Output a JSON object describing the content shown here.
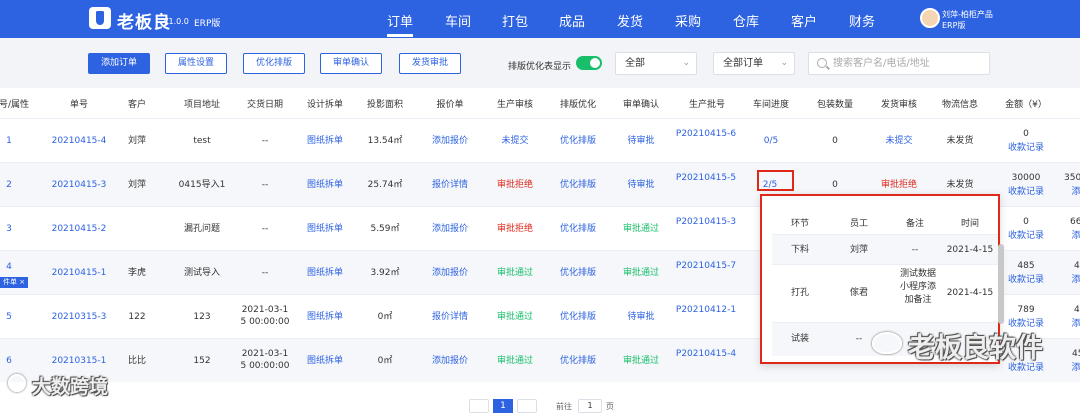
{
  "header": {
    "brand": "老板良",
    "version": "V1.0.0",
    "edition": "ERP版",
    "nav": [
      "订单",
      "车间",
      "打包",
      "成品",
      "发货",
      "采购",
      "仓库",
      "客户",
      "财务"
    ],
    "active_nav": "订单",
    "user_name": "刘萍-柏柜产品",
    "user_role": "ERP版"
  },
  "toolbar": {
    "buttons": [
      "添加订单",
      "属性设置",
      "优化排版",
      "审单确认",
      "发货审批"
    ],
    "toggle_label": "排版优化表显示",
    "toggle_on": true,
    "select1": "全部",
    "select2": "全部订单",
    "search_placeholder": "搜索客户名/电话/地址"
  },
  "table": {
    "headers": [
      "号/属性",
      "单号",
      "客户",
      "项目地址",
      "交货日期",
      "设计拆单",
      "投影面积",
      "报价单",
      "生产审核",
      "排版优化",
      "审单确认",
      "生产批号",
      "车间进度",
      "包装数量",
      "发货审核",
      "物流信息",
      "金额（¥）"
    ],
    "rows": [
      {
        "no": "1",
        "tag": "",
        "order": "20210415-4",
        "customer": "刘萍",
        "address": "test",
        "date": "--",
        "design": "图纸拆单",
        "area": "13.54㎡",
        "quote": "添加报价",
        "prod_review": "未提交",
        "layout": "优化排版",
        "confirm": "待审批",
        "batch": "P20210415-6",
        "progress": "0/5",
        "pack": "0",
        "ship_review": "未提交",
        "logistics": "未发货",
        "amount": "0",
        "amount_link": "收款记录",
        "extra": "",
        "extra2": ""
      },
      {
        "no": "2",
        "tag": "",
        "order": "20210415-3",
        "customer": "刘萍",
        "address": "0415导入1",
        "date": "--",
        "design": "图纸拆单",
        "area": "25.74㎡",
        "quote": "报价详情",
        "prod_review": "审批拒绝",
        "layout": "优化排版",
        "confirm": "待审批",
        "batch": "P20210415-5",
        "progress": "2/5",
        "pack": "0",
        "ship_review": "审批拒绝",
        "logistics": "未发货",
        "amount": "30000",
        "amount_link": "收款记录",
        "extra": "350",
        "extra2": "添"
      },
      {
        "no": "3",
        "tag": "",
        "order": "20210415-2",
        "customer": "",
        "address": "漏孔问题",
        "date": "--",
        "design": "图纸拆单",
        "area": "5.59㎡",
        "quote": "添加报价",
        "prod_review": "审批拒绝",
        "layout": "优化排版",
        "confirm": "审批通过",
        "batch": "P20210415-3",
        "progress": "",
        "pack": "",
        "ship_review": "",
        "logistics": "",
        "amount": "0",
        "amount_link": "收款记录",
        "extra": "66",
        "extra2": "添"
      },
      {
        "no": "4",
        "tag": "件单 ×",
        "order": "20210415-1",
        "customer": "李虎",
        "address": "测试导入",
        "date": "--",
        "design": "图纸拆单",
        "area": "3.92㎡",
        "quote": "添加报价",
        "prod_review": "审批通过",
        "layout": "优化排版",
        "confirm": "审批通过",
        "batch": "P20210415-7",
        "progress": "",
        "pack": "",
        "ship_review": "",
        "logistics": "",
        "amount": "485",
        "amount_link": "收款记录",
        "extra": "4",
        "extra2": "添"
      },
      {
        "no": "5",
        "tag": "",
        "order": "20210315-3",
        "customer": "122",
        "address": "123",
        "date": "2021-03-15 00:00:00",
        "design": "图纸拆单",
        "area": "0㎡",
        "quote": "报价详情",
        "prod_review": "审批通过",
        "layout": "优化排版",
        "confirm": "待审批",
        "batch": "P20210412-1",
        "progress": "",
        "pack": "",
        "ship_review": "",
        "logistics": "",
        "amount": "789",
        "amount_link": "收款记录",
        "extra": "4",
        "extra2": "添"
      },
      {
        "no": "6",
        "tag": "",
        "order": "20210315-1",
        "customer": "比比",
        "address": "152",
        "date": "2021-03-15 00:00:00",
        "design": "图纸拆单",
        "area": "0㎡",
        "quote": "添加报价",
        "prod_review": "审批通过",
        "layout": "优化排版",
        "confirm": "审批通过",
        "batch": "P20210415-4",
        "progress": "",
        "pack": "",
        "ship_review": "",
        "logistics": "",
        "amount": "",
        "amount_link": "收款记录",
        "extra": "45",
        "extra2": "添"
      }
    ]
  },
  "popover": {
    "headers": [
      "环节",
      "员工",
      "备注",
      "时间"
    ],
    "rows": [
      {
        "step": "下料",
        "staff": "刘萍",
        "note": "--",
        "time": "2021-4-15"
      },
      {
        "step": "打孔",
        "staff": "傢君",
        "note": "测试数据小程序添加备注",
        "time": "2021-4-15"
      },
      {
        "step": "试装",
        "staff": "--",
        "note": "--",
        "time": "--"
      }
    ]
  },
  "pagination": {
    "current": "1",
    "goto_label": "前往",
    "goto_value": "1",
    "page_suffix": "页"
  },
  "watermarks": {
    "left": "大数跨境",
    "right": "老板良软件"
  },
  "colors": {
    "primary": "#2d62e1",
    "danger": "#e0281a",
    "success": "#19be6b"
  }
}
